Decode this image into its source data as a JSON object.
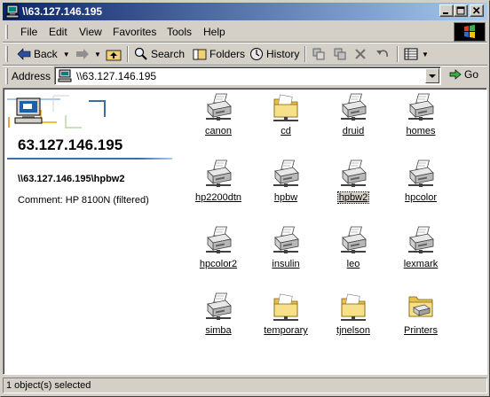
{
  "window": {
    "title": "\\\\63.127.146.195"
  },
  "menu": [
    "File",
    "Edit",
    "View",
    "Favorites",
    "Tools",
    "Help"
  ],
  "toolbar": {
    "back": "Back",
    "search": "Search",
    "folders": "Folders",
    "history": "History"
  },
  "address": {
    "label": "Address",
    "value": "\\\\63.127.146.195",
    "go": "Go"
  },
  "infopane": {
    "title": "63.127.146.195",
    "path": "\\\\63.127.146.195\\hpbw2",
    "comment": "Comment: HP 8100N (filtered)"
  },
  "items": [
    {
      "label": "canon",
      "type": "printer"
    },
    {
      "label": "cd",
      "type": "folder"
    },
    {
      "label": "druid",
      "type": "printer"
    },
    {
      "label": "homes",
      "type": "printer"
    },
    {
      "label": "hp2200dtn",
      "type": "printer"
    },
    {
      "label": "hpbw",
      "type": "printer"
    },
    {
      "label": "hpbw2",
      "type": "printer",
      "selected": true
    },
    {
      "label": "hpcolor",
      "type": "printer"
    },
    {
      "label": "hpcolor2",
      "type": "printer"
    },
    {
      "label": "insulin",
      "type": "printer"
    },
    {
      "label": "leo",
      "type": "printer"
    },
    {
      "label": "lexmark",
      "type": "printer"
    },
    {
      "label": "simba",
      "type": "printer"
    },
    {
      "label": "temporary",
      "type": "folder"
    },
    {
      "label": "tjnelson",
      "type": "folder"
    },
    {
      "label": "Printers",
      "type": "printers-folder"
    }
  ],
  "status": {
    "text": "1 object(s) selected"
  },
  "colors": {
    "titlebar": "#0a246a",
    "face": "#d4d0c8",
    "accent": "#3a6ea5"
  }
}
